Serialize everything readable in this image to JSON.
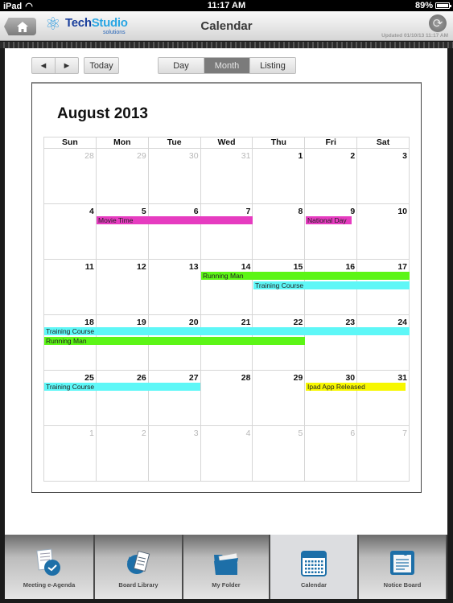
{
  "status_bar": {
    "device": "iPad",
    "time": "11:17 AM",
    "battery": "89%",
    "battery_level": 0.89
  },
  "navbar": {
    "title": "Calendar",
    "logo_brand_a": "Tech",
    "logo_brand_b": "Studio",
    "logo_sub": "solutions",
    "updated": "Updated 01/10/13 11:17 AM",
    "home_icon": "home-icon",
    "refresh_icon": "refresh-icon"
  },
  "toolbar": {
    "prev": "◄",
    "next": "►",
    "today": "Today",
    "views": [
      {
        "label": "Day",
        "active": false
      },
      {
        "label": "Month",
        "active": true
      },
      {
        "label": "Listing",
        "active": false
      }
    ]
  },
  "calendar": {
    "title": "August 2013",
    "weekdays": [
      "Sun",
      "Mon",
      "Tue",
      "Wed",
      "Thu",
      "Fri",
      "Sat"
    ],
    "weeks": [
      [
        {
          "d": "28",
          "o": true
        },
        {
          "d": "29",
          "o": true
        },
        {
          "d": "30",
          "o": true
        },
        {
          "d": "31",
          "o": true
        },
        {
          "d": "1"
        },
        {
          "d": "2"
        },
        {
          "d": "3"
        }
      ],
      [
        {
          "d": "4"
        },
        {
          "d": "5"
        },
        {
          "d": "6"
        },
        {
          "d": "7"
        },
        {
          "d": "8"
        },
        {
          "d": "9"
        },
        {
          "d": "10"
        }
      ],
      [
        {
          "d": "11"
        },
        {
          "d": "12"
        },
        {
          "d": "13"
        },
        {
          "d": "14"
        },
        {
          "d": "15"
        },
        {
          "d": "16"
        },
        {
          "d": "17"
        }
      ],
      [
        {
          "d": "18"
        },
        {
          "d": "19"
        },
        {
          "d": "20"
        },
        {
          "d": "21"
        },
        {
          "d": "22"
        },
        {
          "d": "23"
        },
        {
          "d": "24"
        }
      ],
      [
        {
          "d": "25"
        },
        {
          "d": "26"
        },
        {
          "d": "27"
        },
        {
          "d": "28"
        },
        {
          "d": "29"
        },
        {
          "d": "30"
        },
        {
          "d": "31"
        }
      ],
      [
        {
          "d": "1",
          "o": true
        },
        {
          "d": "2",
          "o": true
        },
        {
          "d": "3",
          "o": true
        },
        {
          "d": "4",
          "o": true
        },
        {
          "d": "5",
          "o": true
        },
        {
          "d": "6",
          "o": true
        },
        {
          "d": "7",
          "o": true
        }
      ]
    ],
    "events": [
      {
        "title": "Movie Time",
        "week": 1,
        "start": 1,
        "end": 3,
        "lane": 0,
        "color": "#e63cc0"
      },
      {
        "title": "National Day",
        "week": 1,
        "start": 5,
        "end": 5,
        "lane": 0,
        "color": "#e63cc0",
        "partial": 0.92
      },
      {
        "title": "Running Man",
        "week": 2,
        "start": 3,
        "end": 6,
        "lane": 0,
        "color": "#5cf516"
      },
      {
        "title": "Training Course",
        "week": 2,
        "start": 4,
        "end": 6,
        "lane": 1,
        "color": "#5ef7f7"
      },
      {
        "title": "Training Course",
        "week": 3,
        "start": 0,
        "end": 6,
        "lane": 0,
        "color": "#5ef7f7"
      },
      {
        "title": "Running Man",
        "week": 3,
        "start": 0,
        "end": 4,
        "lane": 1,
        "color": "#5cf516"
      },
      {
        "title": "Training Course",
        "week": 4,
        "start": 0,
        "end": 2,
        "lane": 0,
        "color": "#5ef7f7"
      },
      {
        "title": "Ipad App Released",
        "week": 4,
        "start": 5,
        "end": 6,
        "lane": 0,
        "color": "#f7f700",
        "partial": 0.96
      }
    ]
  },
  "tabbar": {
    "tabs": [
      {
        "label": "Meeting e-Agenda",
        "icon": "agenda-icon",
        "active": false
      },
      {
        "label": "Board Library",
        "icon": "library-icon",
        "active": false
      },
      {
        "label": "My Folder",
        "icon": "folder-icon",
        "active": false
      },
      {
        "label": "Calendar",
        "icon": "calendar-icon",
        "active": true
      },
      {
        "label": "Notice Board",
        "icon": "notice-board-icon",
        "active": false
      }
    ],
    "icon_color": "#1d6fa8"
  }
}
